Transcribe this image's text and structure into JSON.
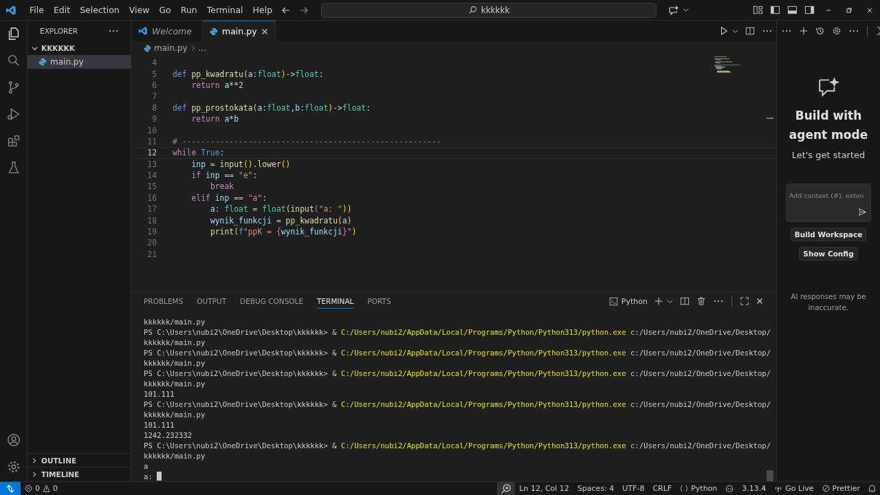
{
  "menu": [
    "File",
    "Edit",
    "Selection",
    "View",
    "Go",
    "Run",
    "Terminal",
    "Help"
  ],
  "search": {
    "value": "kkkkkk"
  },
  "explorer": {
    "title": "EXPLORER",
    "folder": {
      "label": "KKKKKK",
      "expanded": true,
      "children": [
        {
          "label": "main.py",
          "selected": true
        }
      ]
    },
    "sections": [
      {
        "label": "OUTLINE",
        "expanded": false
      },
      {
        "label": "TIMELINE",
        "expanded": false
      }
    ]
  },
  "tabs": [
    {
      "label": "Welcome",
      "kind": "welcome",
      "selected": false
    },
    {
      "label": "main.py",
      "kind": "python",
      "selected": true
    }
  ],
  "breadcrumb": [
    "main.py",
    "..."
  ],
  "code": [
    {
      "number": "4",
      "current": false
    },
    {
      "number": "5",
      "current": false,
      "tokens": [
        {
          "text": "def",
          "kind": "storage"
        },
        {
          "text": " pp_kwadratu",
          "kind": "func"
        },
        {
          "text": "(",
          "kind": "paren"
        },
        {
          "text": "a",
          "kind": "var"
        },
        {
          "text": ":",
          "kind": "plain"
        },
        {
          "text": "float",
          "kind": "type"
        },
        {
          "text": ")",
          "kind": "paren"
        },
        {
          "text": "->",
          "kind": "plain"
        },
        {
          "text": "float",
          "kind": "type"
        },
        {
          "text": ":",
          "kind": "plain"
        }
      ]
    },
    {
      "number": "6",
      "current": false,
      "tokens": [
        {
          "text": "    return",
          "kind": "control"
        },
        {
          "text": " a",
          "kind": "var"
        },
        {
          "text": "**2",
          "kind": "plain"
        }
      ]
    },
    {
      "number": "7",
      "current": false
    },
    {
      "number": "8",
      "current": false,
      "tokens": [
        {
          "text": "def",
          "kind": "storage"
        },
        {
          "text": " pp_prostokata",
          "kind": "func"
        },
        {
          "text": "(",
          "kind": "paren"
        },
        {
          "text": "a",
          "kind": "var"
        },
        {
          "text": ":",
          "kind": "plain"
        },
        {
          "text": "float",
          "kind": "type"
        },
        {
          "text": ",",
          "kind": "plain"
        },
        {
          "text": "b",
          "kind": "var"
        },
        {
          "text": ":",
          "kind": "plain"
        },
        {
          "text": "float",
          "kind": "type"
        },
        {
          "text": ")",
          "kind": "paren"
        },
        {
          "text": "->",
          "kind": "plain"
        },
        {
          "text": "float",
          "kind": "type"
        },
        {
          "text": ":",
          "kind": "plain"
        }
      ]
    },
    {
      "number": "9",
      "current": false,
      "tokens": [
        {
          "text": "    return",
          "kind": "control"
        },
        {
          "text": " a",
          "kind": "var"
        },
        {
          "text": "*",
          "kind": "plain"
        },
        {
          "text": "b",
          "kind": "var"
        }
      ]
    },
    {
      "number": "10",
      "current": false
    },
    {
      "number": "11",
      "current": false,
      "tokens": [
        {
          "text": "# -------------------------------------------------------",
          "kind": "comment"
        }
      ]
    },
    {
      "number": "12",
      "current": true,
      "tokens": [
        {
          "text": "while",
          "kind": "control"
        },
        {
          "text": " True",
          "kind": "storage"
        },
        {
          "text": ":",
          "kind": "plain"
        }
      ]
    },
    {
      "number": "13",
      "current": false,
      "tokens": [
        {
          "text": "    inp",
          "kind": "var"
        },
        {
          "text": " = ",
          "kind": "plain"
        },
        {
          "text": "input",
          "kind": "func"
        },
        {
          "text": "()",
          "kind": "paren"
        },
        {
          "text": ".lower",
          "kind": "func"
        },
        {
          "text": "()",
          "kind": "paren"
        }
      ]
    },
    {
      "number": "14",
      "current": false,
      "tokens": [
        {
          "text": "    if",
          "kind": "control"
        },
        {
          "text": " inp",
          "kind": "var"
        },
        {
          "text": " == ",
          "kind": "plain"
        },
        {
          "text": "\"e\"",
          "kind": "string"
        },
        {
          "text": ":",
          "kind": "plain"
        }
      ]
    },
    {
      "number": "15",
      "current": false,
      "tokens": [
        {
          "text": "        break",
          "kind": "control"
        }
      ]
    },
    {
      "number": "16",
      "current": false,
      "tokens": [
        {
          "text": "    elif",
          "kind": "control"
        },
        {
          "text": " inp",
          "kind": "var"
        },
        {
          "text": " == ",
          "kind": "plain"
        },
        {
          "text": "\"a\"",
          "kind": "string"
        },
        {
          "text": ":",
          "kind": "plain"
        }
      ]
    },
    {
      "number": "17",
      "current": false,
      "tokens": [
        {
          "text": "        a",
          "kind": "var"
        },
        {
          "text": ": ",
          "kind": "plain"
        },
        {
          "text": "float",
          "kind": "type"
        },
        {
          "text": " = ",
          "kind": "plain"
        },
        {
          "text": "float",
          "kind": "type"
        },
        {
          "text": "(",
          "kind": "paren"
        },
        {
          "text": "input",
          "kind": "func"
        },
        {
          "text": "(",
          "kind": "paren2"
        },
        {
          "text": "\"a: \"",
          "kind": "string"
        },
        {
          "text": "))",
          "kind": "paren"
        }
      ]
    },
    {
      "number": "18",
      "current": false,
      "tokens": [
        {
          "text": "        wynik_funkcji",
          "kind": "var"
        },
        {
          "text": " = ",
          "kind": "plain"
        },
        {
          "text": "pp_kwadratu",
          "kind": "func"
        },
        {
          "text": "(",
          "kind": "paren"
        },
        {
          "text": "a",
          "kind": "var"
        },
        {
          "text": ")",
          "kind": "paren"
        }
      ]
    },
    {
      "number": "19",
      "current": false,
      "tokens": [
        {
          "text": "        print",
          "kind": "func"
        },
        {
          "text": "(",
          "kind": "paren"
        },
        {
          "text": "f",
          "kind": "storage"
        },
        {
          "text": "\"ppK = ",
          "kind": "string"
        },
        {
          "text": "{",
          "kind": "paren2"
        },
        {
          "text": "wynik_funkcji",
          "kind": "var"
        },
        {
          "text": "}",
          "kind": "paren2"
        },
        {
          "text": "\"",
          "kind": "string"
        },
        {
          "text": ")",
          "kind": "paren"
        }
      ]
    },
    {
      "number": "20",
      "current": false
    },
    {
      "number": "21",
      "current": false
    }
  ],
  "panel_tabs": [
    {
      "label": "PROBLEMS",
      "selected": false
    },
    {
      "label": "OUTPUT",
      "selected": false
    },
    {
      "label": "DEBUG CONSOLE",
      "selected": false
    },
    {
      "label": "TERMINAL",
      "selected": true
    },
    {
      "label": "PORTS",
      "selected": false
    }
  ],
  "terminal_profile": "Python",
  "terminal": [
    [
      {
        "text": "kkkkkk/main.py",
        "kind": "plain"
      }
    ],
    [
      {
        "text": "PS C:\\Users\\nubi2\\OneDrive\\Desktop\\kkkkkk> & ",
        "kind": "plain"
      },
      {
        "text": "C:/Users/nubi2/AppData/Local/Programs/Python/Python313/python.exe",
        "kind": "path"
      },
      {
        "text": " c:/Users/nubi2/OneDrive/Desktop/",
        "kind": "plain"
      }
    ],
    [
      {
        "text": "kkkkkk/main.py",
        "kind": "plain"
      }
    ],
    [
      {
        "text": "PS C:\\Users\\nubi2\\OneDrive\\Desktop\\kkkkkk> & ",
        "kind": "plain"
      },
      {
        "text": "C:/Users/nubi2/AppData/Local/Programs/Python/Python313/python.exe",
        "kind": "path"
      },
      {
        "text": " c:/Users/nubi2/OneDrive/Desktop/",
        "kind": "plain"
      }
    ],
    [
      {
        "text": "kkkkkk/main.py",
        "kind": "plain"
      }
    ],
    [
      {
        "text": "PS C:\\Users\\nubi2\\OneDrive\\Desktop\\kkkkkk> & ",
        "kind": "plain"
      },
      {
        "text": "C:/Users/nubi2/AppData/Local/Programs/Python/Python313/python.exe",
        "kind": "path"
      },
      {
        "text": " c:/Users/nubi2/OneDrive/Desktop/",
        "kind": "plain"
      }
    ],
    [
      {
        "text": "kkkkkk/main.py",
        "kind": "plain"
      }
    ],
    [
      {
        "text": "101.111",
        "kind": "plain"
      }
    ],
    [
      {
        "text": "PS C:\\Users\\nubi2\\OneDrive\\Desktop\\kkkkkk> & ",
        "kind": "plain"
      },
      {
        "text": "C:/Users/nubi2/AppData/Local/Programs/Python/Python313/python.exe",
        "kind": "path"
      },
      {
        "text": " c:/Users/nubi2/OneDrive/Desktop/",
        "kind": "plain"
      }
    ],
    [
      {
        "text": "kkkkkk/main.py",
        "kind": "plain"
      }
    ],
    [
      {
        "text": "101.111",
        "kind": "plain"
      }
    ],
    [
      {
        "text": "1242.232332",
        "kind": "plain"
      }
    ],
    [
      {
        "text": "PS C:\\Users\\nubi2\\OneDrive\\Desktop\\kkkkkk> & ",
        "kind": "plain"
      },
      {
        "text": "C:/Users/nubi2/AppData/Local/Programs/Python/Python313/python.exe",
        "kind": "path"
      },
      {
        "text": " c:/Users/nubi2/OneDrive/Desktop/",
        "kind": "plain"
      }
    ],
    [
      {
        "text": "kkkkkk/main.py",
        "kind": "plain"
      }
    ],
    [
      {
        "text": "a",
        "kind": "plain"
      }
    ],
    [
      {
        "text": "a:",
        "kind": "prompt"
      }
    ]
  ],
  "chat": {
    "title": "Build with agent mode",
    "subtitle": "Let's get started",
    "input": {
      "placeholder": "Add context (#), exten"
    },
    "buttons": [
      "Build Workspace",
      "Show Config"
    ],
    "note": "AI responses may be inaccurate."
  },
  "status": {
    "errors": "0",
    "warnings": "0",
    "position": "Ln 12, Col 12",
    "spaces": "Spaces: 4",
    "encoding": "UTF-8",
    "eol": "CRLF",
    "language": "Python",
    "version": "3.13.4",
    "golive": "Go Live",
    "prettier": "Prettier"
  }
}
